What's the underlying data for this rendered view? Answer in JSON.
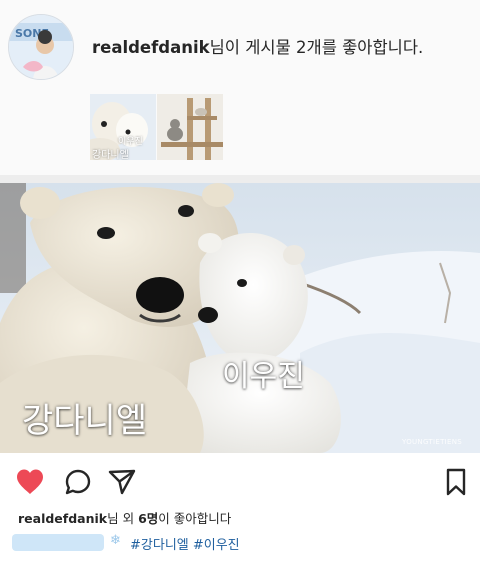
{
  "notification": {
    "username": "realdefdanik",
    "message": "님이 게시물 2개를 좋아합니다.",
    "thumbnail_captions": [
      "이우진",
      "강다니엘"
    ]
  },
  "post": {
    "image_captions": {
      "big": "강다니엘",
      "small": "이우진"
    },
    "watermark": "YOUNGTIETIENS",
    "actions": {
      "like_icon": "heart-filled-icon",
      "comment_icon": "comment-bubble-icon",
      "share_icon": "paper-plane-icon",
      "save_icon": "bookmark-icon"
    },
    "likes": {
      "username": "realdefdanik",
      "text_mid": "님 외 ",
      "count": "6명",
      "text_end": "이 좋아합니다"
    },
    "hashtags": "#강다니엘 #이우진"
  },
  "colors": {
    "like_red": "#ed4956",
    "hashtag_blue": "#1f5f9e",
    "text": "#262626"
  }
}
